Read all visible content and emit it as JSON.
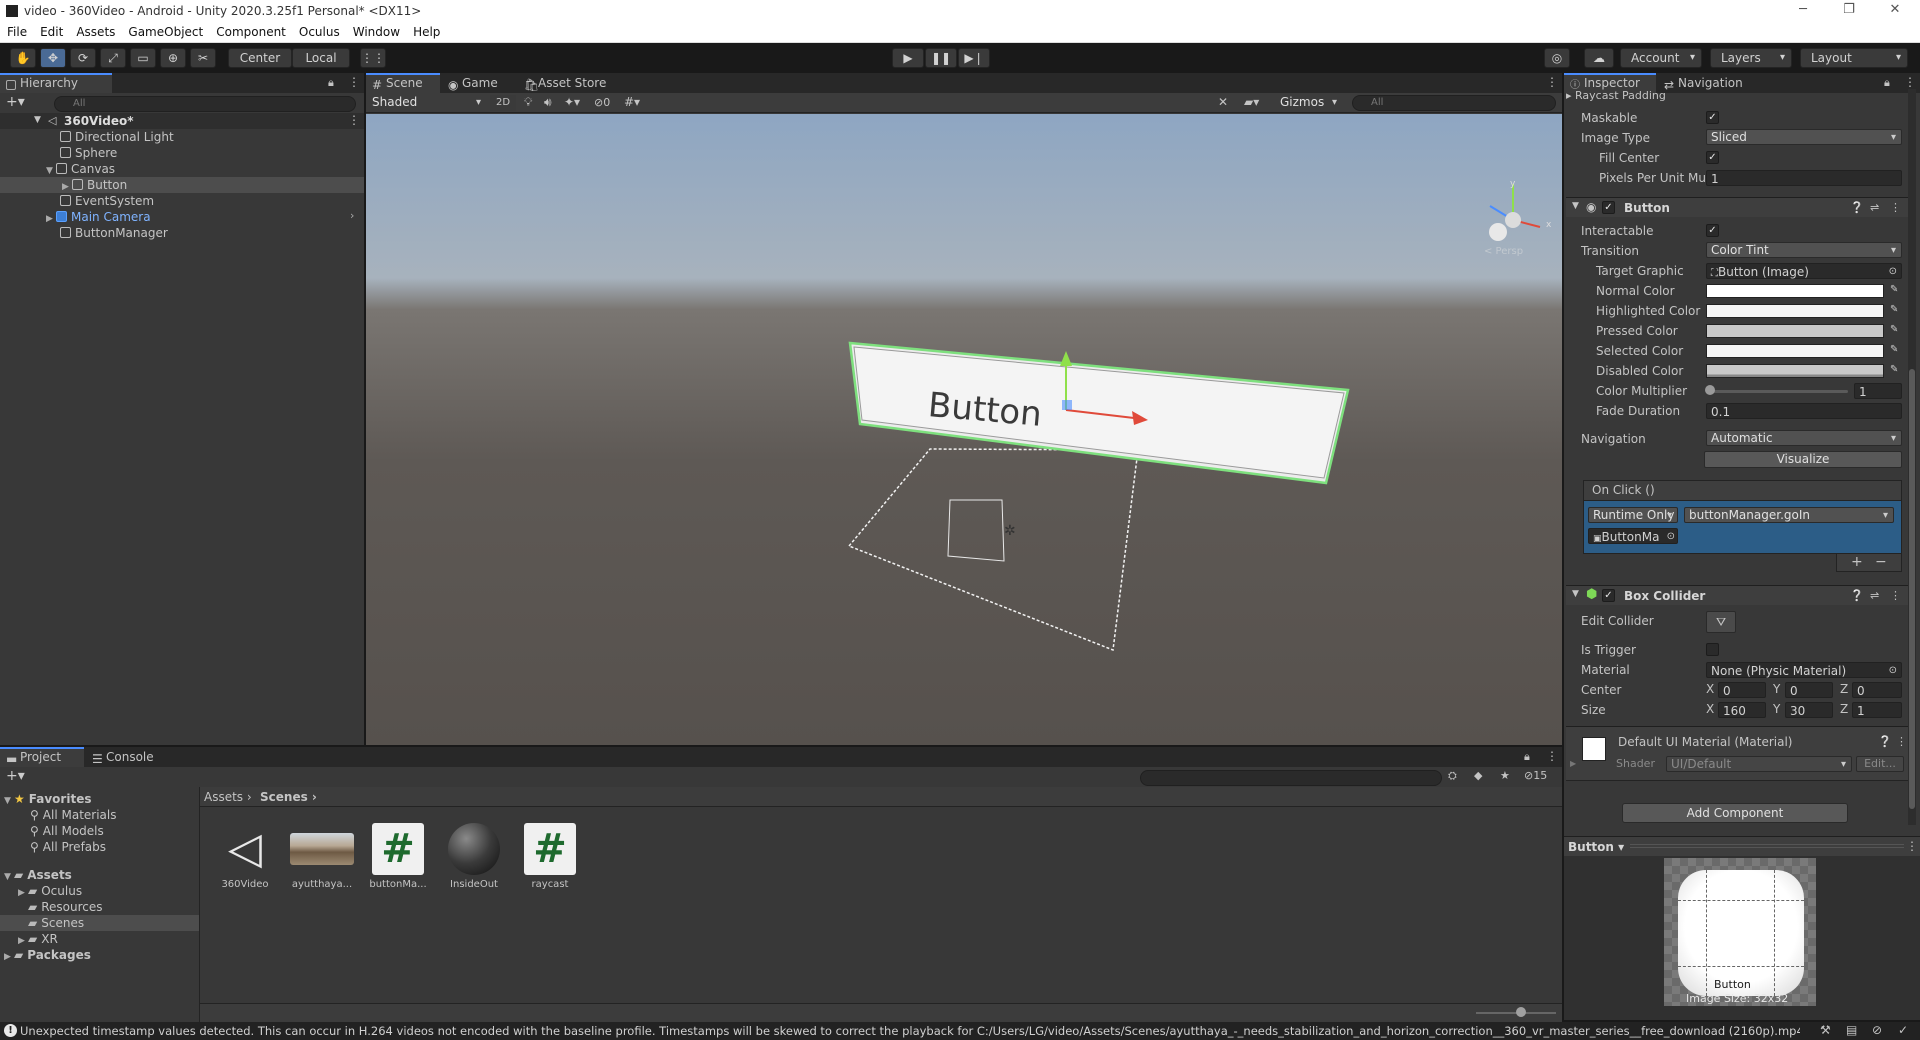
{
  "window": {
    "title": "video - 360Video - Android - Unity 2020.3.25f1 Personal* <DX11>",
    "controls": [
      "─",
      "❐",
      "✕"
    ]
  },
  "menu": [
    "File",
    "Edit",
    "Assets",
    "GameObject",
    "Component",
    "Oculus",
    "Window",
    "Help"
  ],
  "toolbar": {
    "pivot_center": "Center",
    "pivot_local": "Local",
    "account": "Account",
    "layers": "Layers",
    "layout": "Layout"
  },
  "hierarchy": {
    "tab": "Hierarchy",
    "search_placeholder": "All",
    "scene": "360Video*",
    "items": [
      {
        "label": "Directional Light",
        "depth": 1
      },
      {
        "label": "Sphere",
        "depth": 1
      },
      {
        "label": "Canvas",
        "depth": 1
      },
      {
        "label": "Button",
        "depth": 2
      },
      {
        "label": "EventSystem",
        "depth": 1
      },
      {
        "label": "Main Camera",
        "depth": 1
      },
      {
        "label": "ButtonManager",
        "depth": 1
      }
    ]
  },
  "scene_view": {
    "tabs": [
      "Scene",
      "Game",
      "Asset Store"
    ],
    "shading": "Shaded",
    "mode_2d": "2D",
    "hidden_count": "0",
    "gizmos": "Gizmos",
    "search_placeholder": "All",
    "persp_label": "< Persp",
    "button_text": "Button"
  },
  "inspector": {
    "tabs": [
      "Inspector",
      "Navigation"
    ],
    "image": {
      "raycast_padding": "Raycast Padding",
      "maskable": "Maskable",
      "image_type_label": "Image Type",
      "image_type": "Sliced",
      "fill_center": "Fill Center",
      "ppu_label": "Pixels Per Unit Mul",
      "ppu": "1"
    },
    "button": {
      "title": "Button",
      "interactable": "Interactable",
      "transition_label": "Transition",
      "transition": "Color Tint",
      "target_graphic_label": "Target Graphic",
      "target_graphic": "Button (Image)",
      "normal": "Normal Color",
      "highlighted": "Highlighted Color",
      "pressed": "Pressed Color",
      "selected": "Selected Color",
      "disabled": "Disabled Color",
      "multiplier_label": "Color Multiplier",
      "multiplier": "1",
      "fade_label": "Fade Duration",
      "fade": "0.1",
      "navigation_label": "Navigation",
      "navigation": "Automatic",
      "visualize": "Visualize",
      "onclick": "On Click ()",
      "runtime": "Runtime Only",
      "method": "buttonManager.goIn",
      "object": "ButtonMa"
    },
    "box_collider": {
      "title": "Box Collider",
      "edit_collider": "Edit Collider",
      "is_trigger": "Is Trigger",
      "material_label": "Material",
      "material": "None (Physic Material)",
      "center_label": "Center",
      "center": {
        "x": "0",
        "y": "0",
        "z": "0"
      },
      "size_label": "Size",
      "size": {
        "x": "160",
        "y": "30",
        "z": "1"
      }
    },
    "material": {
      "title": "Default UI Material (Material)",
      "shader_label": "Shader",
      "shader": "UI/Default",
      "edit": "Edit..."
    },
    "add_component": "Add Component",
    "preview": {
      "name": "Button",
      "label": "Button",
      "size": "Image Size: 32x32"
    }
  },
  "project": {
    "tabs": [
      "Project",
      "Console"
    ],
    "favorites": "Favorites",
    "fav_items": [
      "All Materials",
      "All Models",
      "All Prefabs"
    ],
    "assets_root": "Assets",
    "asset_folders": [
      "Oculus",
      "Resources",
      "Scenes",
      "XR"
    ],
    "packages": "Packages",
    "breadcrumb": [
      "Assets",
      "Scenes"
    ],
    "hidden_count": "15",
    "files": [
      {
        "name": "360Video",
        "kind": "unity-scene"
      },
      {
        "name": "ayutthaya...",
        "kind": "video"
      },
      {
        "name": "buttonMa...",
        "kind": "script"
      },
      {
        "name": "InsideOut",
        "kind": "material"
      },
      {
        "name": "raycast",
        "kind": "script"
      }
    ]
  },
  "status": {
    "message": "Unexpected timestamp values detected. This can occur in H.264 videos not encoded with the baseline profile. Timestamps will be skewed to correct the playback for C:/Users/LG/video/Assets/Scenes/ayutthaya_-_needs_stabilization_and_horizon_correction__360_vr_master_series__free_download (2160p).mp4"
  }
}
